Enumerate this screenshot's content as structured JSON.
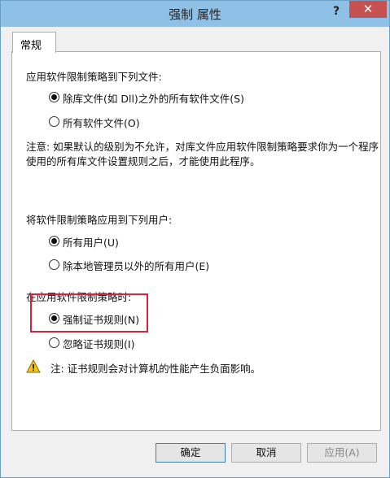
{
  "window": {
    "title": "强制 属性",
    "help_label": "?",
    "close_label": "✕"
  },
  "tab": {
    "label": "常规"
  },
  "section_files": {
    "heading": "应用软件限制策略到下列文件:",
    "options": [
      "除库文件(如 Dll)之外的所有软件文件(S)",
      "所有软件文件(O)"
    ],
    "selected": 0
  },
  "note": {
    "line1": "注意: 如果默认的级别为不允许，对库文件应用软件限制策略要求你为一个程序",
    "line2": "使用的所有库文件设置规则之后，才能使用此程序。"
  },
  "section_users": {
    "heading": "将软件限制策略应用到下列用户:",
    "options": [
      "所有用户(U)",
      "除本地管理员以外的所有用户(E)"
    ],
    "selected": 0
  },
  "section_cert": {
    "heading": "在应用软件限制策略时:",
    "options": [
      "强制证书规则(N)",
      "忽略证书规则(I)"
    ],
    "selected": 0
  },
  "warning": {
    "text": "注: 证书规则会对计算机的性能产生负面影响。"
  },
  "buttons": {
    "ok": "确定",
    "cancel": "取消",
    "apply": "应用(A)"
  },
  "colors": {
    "titlebar": "#8fc0e6",
    "close": "#c75050",
    "highlight": "#e0203a"
  }
}
